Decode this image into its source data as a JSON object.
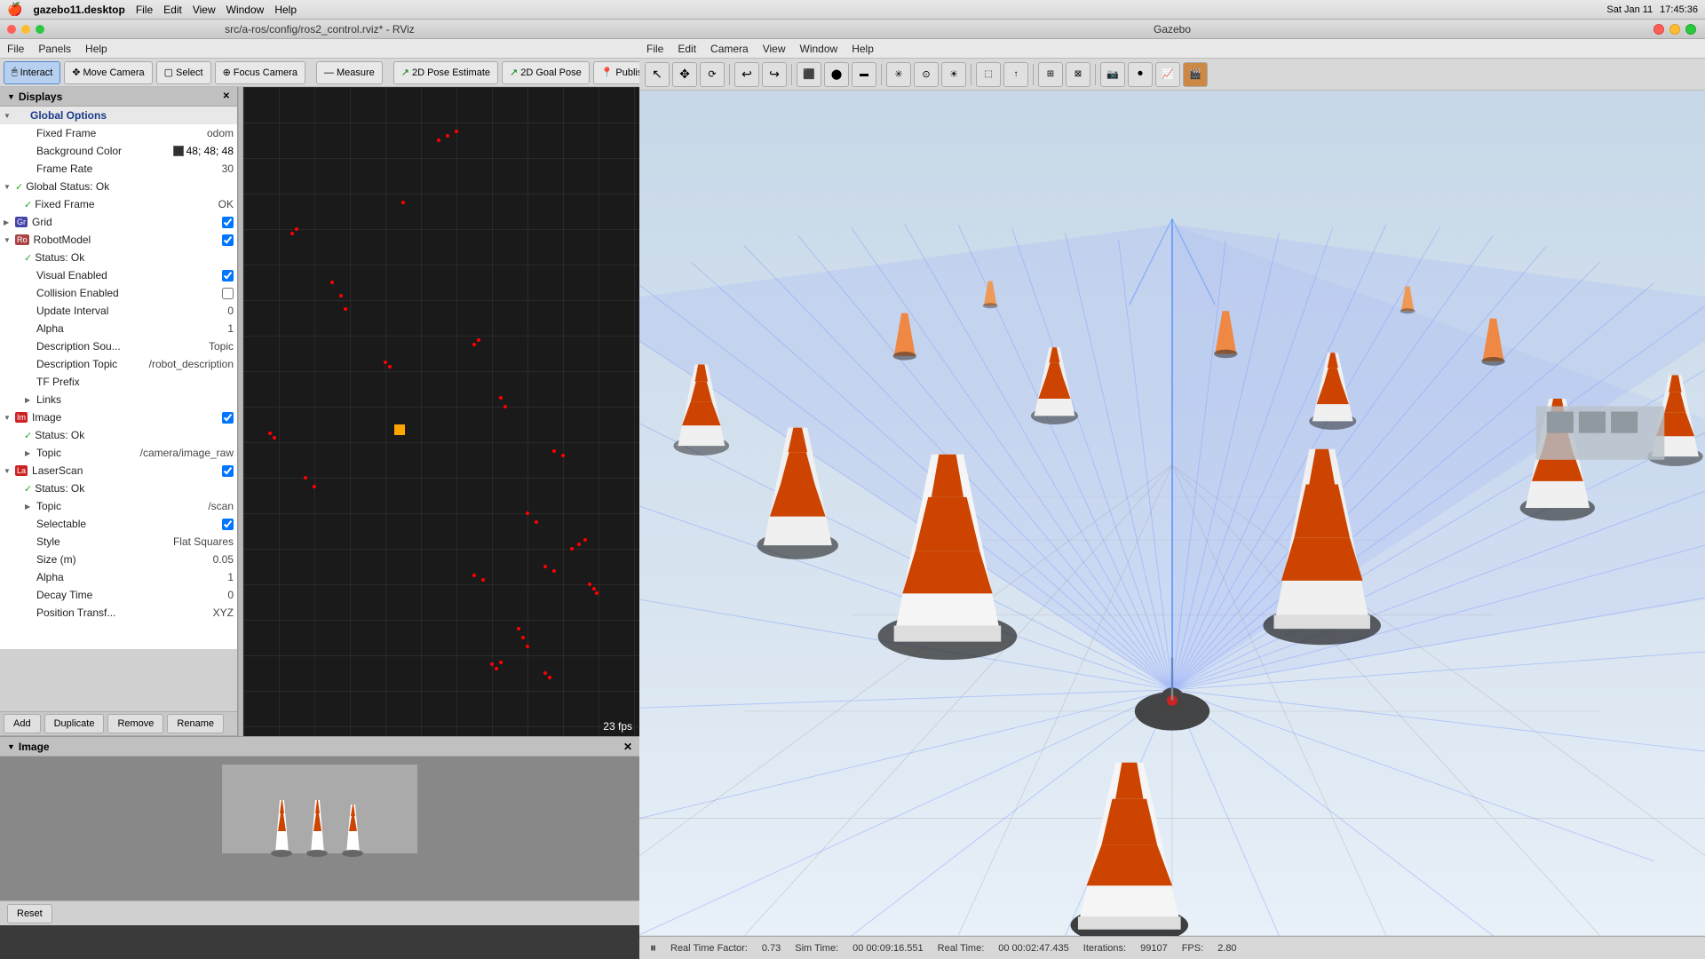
{
  "system": {
    "apple_logo": "🍎",
    "app_name": "gazebo11.desktop",
    "time": "17:45:36",
    "date": "Sat Jan 11"
  },
  "rviz_window": {
    "title": "src/a-ros/config/ros2_control.rviz* - RViz",
    "wm_buttons": [
      "●",
      "●",
      "●"
    ],
    "menu": [
      "File",
      "Panels",
      "Help"
    ],
    "toolbar": {
      "buttons": [
        {
          "label": "Interact",
          "icon": "🖱",
          "active": true
        },
        {
          "label": "Move Camera",
          "icon": "✥",
          "active": false
        },
        {
          "label": "Select",
          "icon": "▢",
          "active": false
        },
        {
          "label": "Focus Camera",
          "icon": "⊕",
          "active": false
        },
        {
          "label": "Measure",
          "icon": "📏",
          "active": false
        },
        {
          "label": "2D Pose Estimate",
          "icon": "↗",
          "active": false
        },
        {
          "label": "2D Goal Pose",
          "icon": "↗",
          "active": false
        },
        {
          "label": "Publish Point",
          "icon": "📍",
          "active": false
        }
      ]
    },
    "fps": "23 fps"
  },
  "displays_panel": {
    "title": "Displays",
    "items": [
      {
        "id": "global-options",
        "name": "Global Options",
        "level": 0,
        "expandable": true,
        "expanded": true,
        "checked": null,
        "value": ""
      },
      {
        "id": "fixed-frame",
        "name": "Fixed Frame",
        "level": 1,
        "expandable": false,
        "checked": null,
        "value": "odom"
      },
      {
        "id": "background-color",
        "name": "Background Color",
        "level": 1,
        "expandable": false,
        "checked": null,
        "value": "48; 48; 48",
        "has_swatch": true
      },
      {
        "id": "frame-rate",
        "name": "Frame Rate",
        "level": 1,
        "expandable": false,
        "checked": null,
        "value": "30"
      },
      {
        "id": "global-status",
        "name": "Global Status: Ok",
        "level": 0,
        "expandable": true,
        "expanded": true,
        "checked": true,
        "value": ""
      },
      {
        "id": "fixed-frame-ok",
        "name": "Fixed Frame",
        "level": 1,
        "expandable": false,
        "checked": true,
        "value": "OK"
      },
      {
        "id": "grid",
        "name": "Grid",
        "level": 0,
        "expandable": true,
        "expanded": false,
        "checked": true,
        "value": ""
      },
      {
        "id": "robot-model",
        "name": "RobotModel",
        "level": 0,
        "expandable": true,
        "expanded": true,
        "checked": true,
        "value": ""
      },
      {
        "id": "robot-status",
        "name": "Status: Ok",
        "level": 1,
        "expandable": false,
        "checked": true,
        "value": ""
      },
      {
        "id": "visual-enabled",
        "name": "Visual Enabled",
        "level": 1,
        "expandable": false,
        "checked": null,
        "value": "✓"
      },
      {
        "id": "collision-enabled",
        "name": "Collision Enabled",
        "level": 1,
        "expandable": false,
        "checked": null,
        "value": "□"
      },
      {
        "id": "update-interval",
        "name": "Update Interval",
        "level": 1,
        "expandable": false,
        "checked": null,
        "value": "0"
      },
      {
        "id": "alpha",
        "name": "Alpha",
        "level": 1,
        "expandable": false,
        "checked": null,
        "value": "1"
      },
      {
        "id": "desc-source",
        "name": "Description Sou...",
        "level": 1,
        "expandable": false,
        "checked": null,
        "value": "Topic"
      },
      {
        "id": "desc-topic",
        "name": "Description Topic",
        "level": 1,
        "expandable": false,
        "checked": null,
        "value": "/robot_description"
      },
      {
        "id": "tf-prefix",
        "name": "TF Prefix",
        "level": 1,
        "expandable": false,
        "checked": null,
        "value": ""
      },
      {
        "id": "links",
        "name": "Links",
        "level": 1,
        "expandable": true,
        "expanded": false,
        "checked": null,
        "value": ""
      },
      {
        "id": "image",
        "name": "Image",
        "level": 0,
        "expandable": true,
        "expanded": true,
        "checked": true,
        "value": "",
        "error": true
      },
      {
        "id": "image-status",
        "name": "Status: Ok",
        "level": 1,
        "expandable": false,
        "checked": true,
        "value": ""
      },
      {
        "id": "image-topic",
        "name": "Topic",
        "level": 1,
        "expandable": false,
        "checked": null,
        "value": "/camera/image_raw"
      },
      {
        "id": "laser-scan",
        "name": "LaserScan",
        "level": 0,
        "expandable": true,
        "expanded": true,
        "checked": true,
        "value": "",
        "error": true
      },
      {
        "id": "laser-status",
        "name": "Status: Ok",
        "level": 1,
        "expandable": false,
        "checked": true,
        "value": ""
      },
      {
        "id": "laser-topic",
        "name": "Topic",
        "level": 1,
        "expandable": true,
        "expanded": false,
        "checked": null,
        "value": "/scan"
      },
      {
        "id": "selectable",
        "name": "Selectable",
        "level": 1,
        "expandable": false,
        "checked": null,
        "value": "✓"
      },
      {
        "id": "style",
        "name": "Style",
        "level": 1,
        "expandable": false,
        "checked": null,
        "value": "Flat Squares"
      },
      {
        "id": "size-m",
        "name": "Size (m)",
        "level": 1,
        "expandable": false,
        "checked": null,
        "value": "0.05"
      },
      {
        "id": "scan-alpha",
        "name": "Alpha",
        "level": 1,
        "expandable": false,
        "checked": null,
        "value": "1"
      },
      {
        "id": "decay-time",
        "name": "Decay Time",
        "level": 1,
        "expandable": false,
        "checked": null,
        "value": "0"
      },
      {
        "id": "position-transf",
        "name": "Position Transf...",
        "level": 1,
        "expandable": false,
        "checked": null,
        "value": "XYZ"
      }
    ],
    "buttons": [
      "Add",
      "Duplicate",
      "Remove",
      "Rename"
    ]
  },
  "image_panel": {
    "title": "Image",
    "close_icon": "✕"
  },
  "gazebo_window": {
    "title": "Gazebo",
    "menu": [
      "File",
      "Edit",
      "Camera",
      "View",
      "Window",
      "Help"
    ],
    "toolbar_icons": [
      "cursor",
      "translate",
      "select-rect",
      "undo",
      "redo",
      "separator",
      "box",
      "sphere",
      "cylinder",
      "point-light",
      "spot-light",
      "directional-light",
      "separator",
      "align",
      "snap",
      "joint",
      "separator",
      "screenshot",
      "record",
      "graph",
      "video"
    ],
    "statusbar": {
      "realtime_factor_label": "Real Time Factor:",
      "realtime_factor": "0.73",
      "sim_time_label": "Sim Time:",
      "sim_time": "00 00:09:16.551",
      "real_time_label": "Real Time:",
      "real_time": "00 00:02:47.435",
      "iterations_label": "Iterations:",
      "iterations": "99107",
      "fps_label": "FPS:",
      "fps": "2.80"
    },
    "play_pause_icon": "⏸"
  },
  "icons": {
    "expand_closed": "▶",
    "expand_open": "▼",
    "check": "✓",
    "close": "✕",
    "apple": "🍎"
  }
}
